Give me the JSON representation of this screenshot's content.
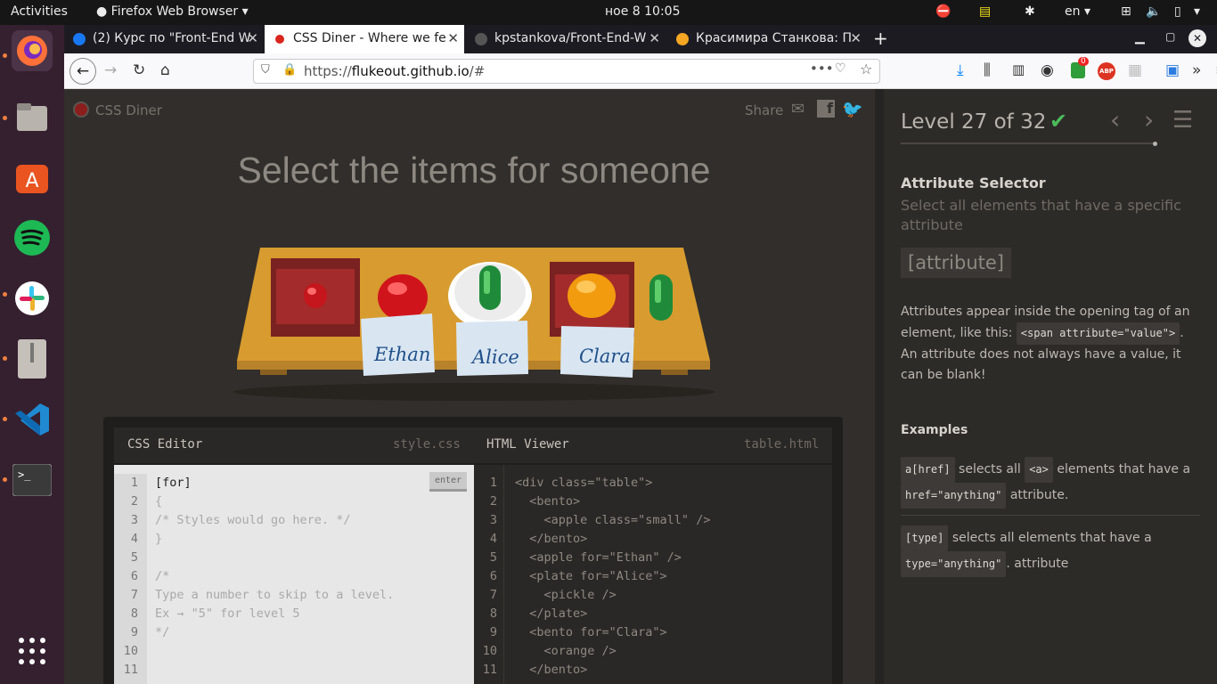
{
  "topbar": {
    "activities": "Activities",
    "app": "Firefox Web Browser",
    "datetime": "ное 8  10:05",
    "lang": "en"
  },
  "tabs": [
    {
      "label": "(2) Курс по \"Front-End W",
      "color": "#1877f2"
    },
    {
      "label": "CSS Diner - Where we fe",
      "color": "#d9261c"
    },
    {
      "label": "kpstankova/Front-End-W",
      "color": "#555555"
    },
    {
      "label": "Красимира Станкова: П",
      "color": "#f5a623"
    }
  ],
  "url": {
    "prefix": "https://",
    "host": "flukeout.github.io",
    "path": "/#"
  },
  "badges": {
    "ublock": "0",
    "abp": "ABP"
  },
  "game": {
    "brand": "CSS Diner",
    "share": "Share",
    "instruction": "Select the items for someone",
    "names": [
      "Ethan",
      "Alice",
      "Clara"
    ],
    "css_editor": "CSS Editor",
    "css_file": "style.css",
    "html_viewer": "HTML Viewer",
    "html_file": "table.html",
    "enter": "enter",
    "css_lines": [
      "[for]",
      "{",
      "/* Styles would go here. */",
      "}",
      "",
      "/*",
      "Type a number to skip to a level.",
      "Ex → \"5\" for level 5",
      "*/",
      "",
      ""
    ],
    "html_lines": [
      "<div class=\"table\">",
      "  <bento>",
      "    <apple class=\"small\" />",
      "  </bento>",
      "  <apple for=\"Ethan\" />",
      "  <plate for=\"Alice\">",
      "    <pickle />",
      "  </plate>",
      "  <bento for=\"Clara\">",
      "    <orange />",
      "  </bento>"
    ],
    "line_numbers": [
      "1",
      "2",
      "3",
      "4",
      "5",
      "6",
      "7",
      "8",
      "9",
      "10",
      "11"
    ]
  },
  "sidebar": {
    "level": "Level 27 of 32",
    "title": "Attribute Selector",
    "subtitle": "Select all elements that have a specific attribute",
    "syntax": "[attribute]",
    "desc_1": "Attributes appear inside the opening tag of an element, like this:",
    "desc_code": "<span attribute=\"value\">",
    "desc_2": ". An attribute does not always have a value, it can be blank!",
    "examples_title": "Examples",
    "ex1_code": "a[href]",
    "ex1_text": "selects all",
    "ex1_code2": "<a>",
    "ex1_text2": "elements that have a",
    "ex1_code3": "href=\"anything\"",
    "ex1_text3": "attribute.",
    "ex2_code": "[type]",
    "ex2_text": "selects all elements that have a",
    "ex2_code2": "type=\"anything\"",
    "ex2_text2": ". attribute"
  }
}
